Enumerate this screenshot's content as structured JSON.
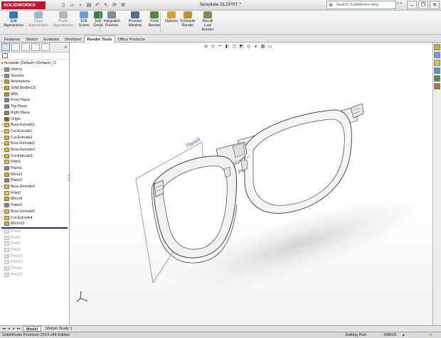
{
  "window": {
    "app_logo": "SOLIDWORKS",
    "document_title": "faceplate.SLDPRT *",
    "help_search_placeholder": "Search SolidWorks Help",
    "help_search_icon": "solidworks-help-icon"
  },
  "quick_access": [
    "new-icon",
    "open-icon",
    "save-icon",
    "print-icon",
    "undo-icon",
    "select-icon",
    "rebuild-icon",
    "options-icon"
  ],
  "command_manager": {
    "buttons": [
      {
        "label": "Edit\nAppearance",
        "icon": "appearance-icon",
        "enabled": true,
        "color": "#2f79c4"
      },
      {
        "label": "Copy\nAppearance",
        "icon": "copy-appearance-icon",
        "enabled": false,
        "color": "#9fb6cc"
      },
      {
        "label": "Paste\nAppearance",
        "icon": "paste-appearance-icon",
        "enabled": false,
        "color": "#b7b7b7"
      },
      {
        "label": "Edit\nScene",
        "icon": "scene-icon",
        "enabled": true,
        "color": "#6aa0cf"
      },
      {
        "label": "Edit\nDecal",
        "icon": "decal-icon",
        "enabled": true,
        "color": "#3d7a3d"
      },
      {
        "label": "Integrated\nPreview",
        "icon": "integrated-preview-icon",
        "enabled": true,
        "color": "#7b8c9c"
      },
      {
        "label": "Preview\nWindow",
        "icon": "preview-window-icon",
        "enabled": true,
        "color": "#50708f"
      },
      {
        "label": "Final\nRender",
        "icon": "final-render-icon",
        "enabled": true,
        "color": "#4f8a38"
      },
      {
        "label": "Options",
        "icon": "options-icon",
        "enabled": true,
        "color": "#d9a52c"
      },
      {
        "label": "Schedule\nRender",
        "icon": "schedule-render-icon",
        "enabled": true,
        "color": "#c7902a"
      },
      {
        "label": "Recall\nLast\nRender",
        "icon": "recall-render-icon",
        "enabled": true,
        "color": "#7d8c55"
      }
    ]
  },
  "tabs": [
    "Features",
    "Sketch",
    "Evaluate",
    "DimXpert",
    "Render Tools",
    "Office Products"
  ],
  "active_tab": "Render Tools",
  "feature_manager": {
    "root": "faceplate  (Default<<Default>_D",
    "items": [
      {
        "label": "History",
        "icon": "history-icon",
        "expandable": true,
        "suppressed": false
      },
      {
        "label": "Sensors",
        "icon": "sensors-icon",
        "expandable": true,
        "suppressed": false
      },
      {
        "label": "Annotations",
        "icon": "annotations-icon",
        "expandable": true,
        "suppressed": false
      },
      {
        "label": "Solid Bodies(3)",
        "icon": "solid-bodies-icon",
        "expandable": true,
        "suppressed": false
      },
      {
        "label": "ABS",
        "icon": "material-icon",
        "expandable": false,
        "suppressed": false
      },
      {
        "label": "Front Plane",
        "icon": "plane-icon",
        "expandable": false,
        "suppressed": false
      },
      {
        "label": "Top Plane",
        "icon": "plane-icon",
        "expandable": false,
        "suppressed": false
      },
      {
        "label": "Right Plane",
        "icon": "plane-icon",
        "expandable": false,
        "suppressed": false
      },
      {
        "label": "Origin",
        "icon": "origin-icon",
        "expandable": false,
        "suppressed": false
      },
      {
        "label": "Boss-Extrude1",
        "icon": "extrude-icon",
        "expandable": true,
        "suppressed": false
      },
      {
        "label": "Cut-Extrude1",
        "icon": "cut-extrude-icon",
        "expandable": true,
        "suppressed": false
      },
      {
        "label": "Cut-Extrude2",
        "icon": "cut-extrude-icon",
        "expandable": true,
        "suppressed": false
      },
      {
        "label": "Boss-Extrude2",
        "icon": "extrude-icon",
        "expandable": true,
        "suppressed": false
      },
      {
        "label": "Boss-Extrude3",
        "icon": "extrude-icon",
        "expandable": true,
        "suppressed": false
      },
      {
        "label": "Cut-Extrude3",
        "icon": "cut-extrude-icon",
        "expandable": true,
        "suppressed": false
      },
      {
        "label": "Fillet1",
        "icon": "fillet-icon",
        "expandable": false,
        "suppressed": false
      },
      {
        "label": "Plane1",
        "icon": "plane-icon",
        "expandable": false,
        "suppressed": false
      },
      {
        "label": "Mirror1",
        "icon": "mirror-icon",
        "expandable": false,
        "suppressed": false
      },
      {
        "label": "Plane2",
        "icon": "plane-icon",
        "expandable": false,
        "suppressed": false
      },
      {
        "label": "Boss-Extrude4",
        "icon": "extrude-icon",
        "expandable": true,
        "suppressed": false
      },
      {
        "label": "Fillet2",
        "icon": "fillet-icon",
        "expandable": false,
        "suppressed": false
      },
      {
        "label": "Mirror8",
        "icon": "mirror-icon",
        "expandable": false,
        "suppressed": false
      },
      {
        "label": "Plane3",
        "icon": "plane-icon",
        "expandable": false,
        "suppressed": false
      },
      {
        "label": "Boss-Extrude5",
        "icon": "extrude-icon",
        "expandable": true,
        "suppressed": false
      },
      {
        "label": "Cut-Extrude4",
        "icon": "cut-extrude-icon",
        "expandable": true,
        "suppressed": false
      },
      {
        "label": "Mirror10",
        "icon": "mirror-icon",
        "expandable": false,
        "suppressed": false
      },
      {
        "label": "Fillet4",
        "icon": "fillet-icon",
        "expandable": false,
        "suppressed": true
      },
      {
        "label": "Fillet5",
        "icon": "fillet-icon",
        "expandable": false,
        "suppressed": true
      },
      {
        "label": "Fillet8",
        "icon": "fillet-icon",
        "expandable": false,
        "suppressed": true
      },
      {
        "label": "Fillet9",
        "icon": "fillet-icon",
        "expandable": false,
        "suppressed": true
      },
      {
        "label": "Fillet10",
        "icon": "fillet-icon",
        "expandable": false,
        "suppressed": true
      },
      {
        "label": "Fillet13",
        "icon": "fillet-icon",
        "expandable": false,
        "suppressed": true
      },
      {
        "label": "Fillet14",
        "icon": "fillet-icon",
        "expandable": false,
        "suppressed": true
      },
      {
        "label": "Fillet23",
        "icon": "fillet-icon",
        "expandable": false,
        "suppressed": true
      }
    ]
  },
  "viewport": {
    "plane_label_1": "Plane3",
    "plane_label_2": "Plane1"
  },
  "bottom_tabs": [
    "Model",
    "Motion Study 1"
  ],
  "active_bottom_tab": "Model",
  "status": {
    "edition": "SolidWorks Premium 2014 x64 Edition",
    "mode": "Editing Part",
    "units": "MMGS"
  },
  "colors": {
    "rollback_bar": "#1a2f6f",
    "brand": "#c8102e",
    "part_fill": "#f4f4f4"
  }
}
